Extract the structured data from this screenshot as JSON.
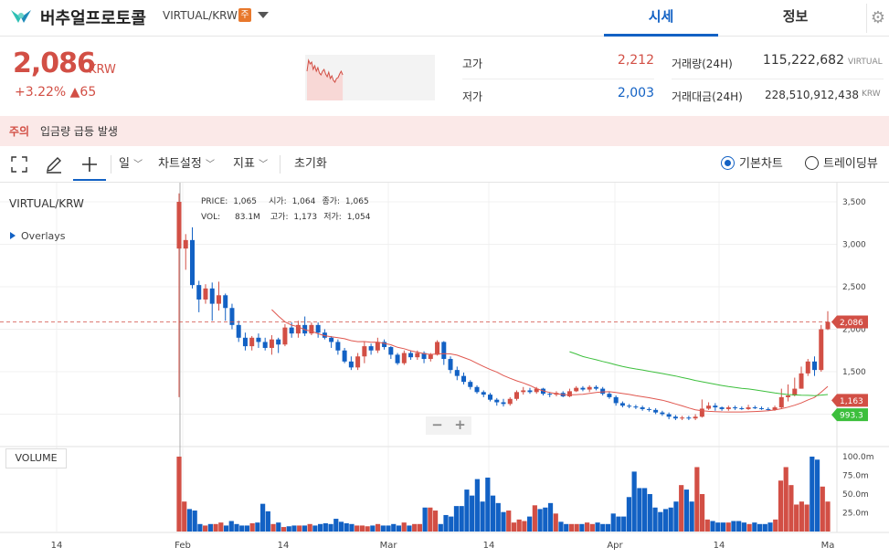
{
  "header": {
    "coin_name": "버추얼프로토콜",
    "market": "VIRTUAL/KRW",
    "caution_badge": "주",
    "tabs": [
      "시세",
      "정보"
    ]
  },
  "ticker": {
    "price": "2,086",
    "unit": "KRW",
    "change": "+3.22% ▲65",
    "high_label": "고가",
    "high": "2,212",
    "low_label": "저가",
    "low": "2,003",
    "volume_label": "거래량(24H)",
    "volume": "115,222,682",
    "volume_unit": "VIRTUAL",
    "value_label": "거래대금(24H)",
    "value": "228,510,912,438",
    "value_unit": "KRW"
  },
  "caution": {
    "label": "주의",
    "text": "입금량 급등 발생"
  },
  "toolbar": {
    "period": "일",
    "chart_settings": "차트설정",
    "indicators": "지표",
    "reset": "초기화",
    "basic_chart": "기본차트",
    "trading_view": "트레이딩뷰"
  },
  "chart": {
    "pair": "VIRTUAL/KRW",
    "overlays": "Overlays",
    "ohlc": {
      "price_label": "PRICE:",
      "price": "1,065",
      "open_label": "시가:",
      "open": "1,064",
      "close_label": "종가:",
      "close": "1,065",
      "vol_label": "VOL:",
      "vol": "83.1M",
      "high_label": "고가:",
      "high": "1,173",
      "low_label": "저가:",
      "low": "1,054"
    },
    "volume_title": "VOLUME",
    "zoom_out": "−",
    "zoom_in": "+"
  },
  "colors": {
    "up": "#d24f45",
    "down": "#1261c4",
    "accent": "#1261c4",
    "ma_short": "#e0574f",
    "ma_long": "#3cbf3c"
  },
  "chart_data": {
    "type": "candlestick",
    "y_ticks": [
      "3,500",
      "3,000",
      "2,500",
      "2,000",
      "1,500"
    ],
    "ylim": [
      1000,
      3600
    ],
    "x_ticks": [
      "14",
      "Feb",
      "14",
      "Mar",
      "14",
      "Apr",
      "14",
      "Ma"
    ],
    "price_badges": [
      {
        "label": "2,086",
        "value": 2086,
        "color": "#d24f45"
      },
      {
        "label": "1,163",
        "value": 1163,
        "color": "#d24f45"
      },
      {
        "label": "993.3",
        "value": 993.3,
        "color": "#3cbf3c"
      }
    ],
    "volume_ticks": [
      "100.0m",
      "75.0m",
      "50.0m",
      "25.0m"
    ],
    "volume_max": 100,
    "candles": [
      [
        3500,
        2950,
        1200,
        3600,
        1
      ],
      [
        2950,
        3050,
        2700,
        3120,
        1
      ],
      [
        3050,
        2520,
        2480,
        3200,
        0
      ],
      [
        2520,
        2350,
        2200,
        2570,
        0
      ],
      [
        2350,
        2480,
        2300,
        2530,
        1
      ],
      [
        2480,
        2300,
        2100,
        2550,
        0
      ],
      [
        2300,
        2400,
        2220,
        2560,
        1
      ],
      [
        2400,
        2250,
        2100,
        2420,
        0
      ],
      [
        2250,
        2050,
        2000,
        2300,
        0
      ],
      [
        2050,
        1900,
        1850,
        2100,
        0
      ],
      [
        1900,
        1800,
        1750,
        1960,
        0
      ],
      [
        1800,
        1900,
        1750,
        1920,
        1
      ],
      [
        1900,
        1850,
        1780,
        1950,
        0
      ],
      [
        1850,
        1780,
        1750,
        1900,
        0
      ],
      [
        1780,
        1880,
        1700,
        1930,
        1
      ],
      [
        1880,
        1820,
        1720,
        1900,
        0
      ],
      [
        1820,
        2020,
        1800,
        2060,
        1
      ],
      [
        2020,
        1950,
        1900,
        2080,
        0
      ],
      [
        1950,
        2050,
        1900,
        2100,
        1
      ],
      [
        2050,
        1950,
        1920,
        2150,
        0
      ],
      [
        1950,
        2050,
        1930,
        2080,
        1
      ],
      [
        2050,
        1960,
        1900,
        2080,
        0
      ],
      [
        1960,
        1900,
        1880,
        2000,
        0
      ],
      [
        1900,
        1850,
        1780,
        1920,
        0
      ],
      [
        1850,
        1750,
        1700,
        1880,
        0
      ],
      [
        1750,
        1620,
        1600,
        1780,
        0
      ],
      [
        1620,
        1550,
        1520,
        1680,
        0
      ],
      [
        1550,
        1680,
        1520,
        1720,
        1
      ],
      [
        1680,
        1800,
        1600,
        1850,
        1
      ],
      [
        1800,
        1750,
        1700,
        1830,
        0
      ],
      [
        1750,
        1850,
        1720,
        1900,
        1
      ],
      [
        1850,
        1790,
        1760,
        1880,
        0
      ],
      [
        1790,
        1700,
        1650,
        1800,
        0
      ],
      [
        1700,
        1600,
        1580,
        1720,
        0
      ],
      [
        1600,
        1720,
        1580,
        1750,
        1
      ],
      [
        1720,
        1670,
        1640,
        1750,
        0
      ],
      [
        1670,
        1720,
        1640,
        1750,
        1
      ],
      [
        1720,
        1650,
        1600,
        1740,
        0
      ],
      [
        1650,
        1700,
        1620,
        1720,
        1
      ],
      [
        1700,
        1850,
        1690,
        1870,
        1
      ],
      [
        1850,
        1650,
        1580,
        1860,
        0
      ],
      [
        1650,
        1520,
        1480,
        1680,
        0
      ],
      [
        1520,
        1450,
        1400,
        1560,
        0
      ],
      [
        1450,
        1380,
        1350,
        1490,
        0
      ],
      [
        1380,
        1320,
        1290,
        1400,
        0
      ],
      [
        1320,
        1260,
        1240,
        1340,
        0
      ],
      [
        1260,
        1230,
        1200,
        1280,
        0
      ],
      [
        1230,
        1170,
        1150,
        1250,
        0
      ],
      [
        1170,
        1140,
        1100,
        1190,
        0
      ],
      [
        1140,
        1120,
        1090,
        1180,
        0
      ],
      [
        1120,
        1180,
        1100,
        1200,
        1
      ],
      [
        1180,
        1260,
        1160,
        1280,
        1
      ],
      [
        1260,
        1280,
        1230,
        1320,
        1
      ],
      [
        1280,
        1260,
        1240,
        1310,
        0
      ],
      [
        1260,
        1300,
        1240,
        1320,
        1
      ],
      [
        1300,
        1240,
        1220,
        1310,
        0
      ],
      [
        1240,
        1230,
        1200,
        1260,
        0
      ],
      [
        1230,
        1250,
        1210,
        1270,
        1
      ],
      [
        1250,
        1210,
        1200,
        1270,
        0
      ],
      [
        1210,
        1270,
        1200,
        1300,
        1
      ],
      [
        1270,
        1310,
        1260,
        1330,
        1
      ],
      [
        1310,
        1290,
        1270,
        1330,
        0
      ],
      [
        1290,
        1320,
        1260,
        1340,
        1
      ],
      [
        1320,
        1300,
        1280,
        1340,
        0
      ],
      [
        1300,
        1240,
        1220,
        1320,
        0
      ],
      [
        1240,
        1200,
        1180,
        1260,
        0
      ],
      [
        1200,
        1130,
        1100,
        1220,
        0
      ],
      [
        1130,
        1100,
        1080,
        1150,
        0
      ],
      [
        1100,
        1090,
        1070,
        1120,
        0
      ],
      [
        1090,
        1080,
        1060,
        1110,
        0
      ],
      [
        1080,
        1060,
        1040,
        1100,
        0
      ],
      [
        1060,
        1050,
        1030,
        1080,
        0
      ],
      [
        1050,
        1020,
        1000,
        1070,
        0
      ],
      [
        1020,
        1000,
        980,
        1040,
        0
      ],
      [
        1000,
        970,
        940,
        1020,
        0
      ],
      [
        970,
        950,
        930,
        990,
        0
      ],
      [
        950,
        960,
        930,
        980,
        1
      ],
      [
        960,
        950,
        930,
        980,
        0
      ],
      [
        950,
        970,
        930,
        1000,
        1
      ],
      [
        970,
        1065,
        960,
        1173,
        1
      ],
      [
        1065,
        1100,
        1050,
        1140,
        1
      ],
      [
        1100,
        1080,
        1040,
        1130,
        0
      ],
      [
        1080,
        1060,
        1040,
        1090,
        0
      ],
      [
        1060,
        1080,
        1040,
        1100,
        1
      ],
      [
        1080,
        1070,
        1050,
        1100,
        0
      ],
      [
        1070,
        1060,
        1050,
        1090,
        0
      ],
      [
        1060,
        1080,
        1050,
        1110,
        1
      ],
      [
        1080,
        1070,
        1060,
        1100,
        0
      ],
      [
        1070,
        1060,
        1050,
        1090,
        0
      ],
      [
        1060,
        1050,
        1040,
        1080,
        0
      ],
      [
        1050,
        1080,
        1040,
        1100,
        1
      ],
      [
        1080,
        1200,
        1060,
        1300,
        1
      ],
      [
        1200,
        1220,
        1150,
        1350,
        1
      ],
      [
        1220,
        1300,
        1210,
        1430,
        1
      ],
      [
        1300,
        1480,
        1300,
        1560,
        1
      ],
      [
        1480,
        1620,
        1450,
        1650,
        1
      ],
      [
        1620,
        1520,
        1450,
        1680,
        0
      ],
      [
        1520,
        2000,
        1500,
        2050,
        1
      ],
      [
        2000,
        2086,
        1990,
        2212,
        1
      ]
    ],
    "volumes": [
      100,
      40,
      30,
      28,
      10,
      8,
      10,
      10,
      12,
      8,
      14,
      10,
      8,
      8,
      11,
      12,
      37,
      27,
      10,
      12,
      6,
      7,
      8,
      8,
      8,
      10,
      8,
      10,
      11,
      10,
      17,
      13,
      11,
      10,
      8,
      8,
      7,
      8,
      10,
      8,
      8,
      10,
      8,
      12,
      8,
      10,
      10,
      32,
      32,
      28,
      10,
      22,
      20,
      34,
      34,
      56,
      48,
      70,
      40,
      72,
      48,
      38,
      26,
      28,
      12,
      16,
      14,
      20,
      35,
      30,
      32,
      38,
      24,
      13,
      10,
      10,
      10,
      10,
      12,
      10,
      12,
      10,
      10,
      24,
      20,
      20,
      46,
      80,
      58,
      58,
      50,
      32,
      26,
      30,
      32,
      40,
      62,
      56,
      40,
      86,
      50,
      16,
      14,
      12,
      12,
      12,
      14,
      14,
      12,
      10,
      12,
      10,
      10,
      12,
      16,
      68,
      86,
      62,
      36,
      40,
      36,
      100,
      96,
      60,
      40
    ]
  }
}
